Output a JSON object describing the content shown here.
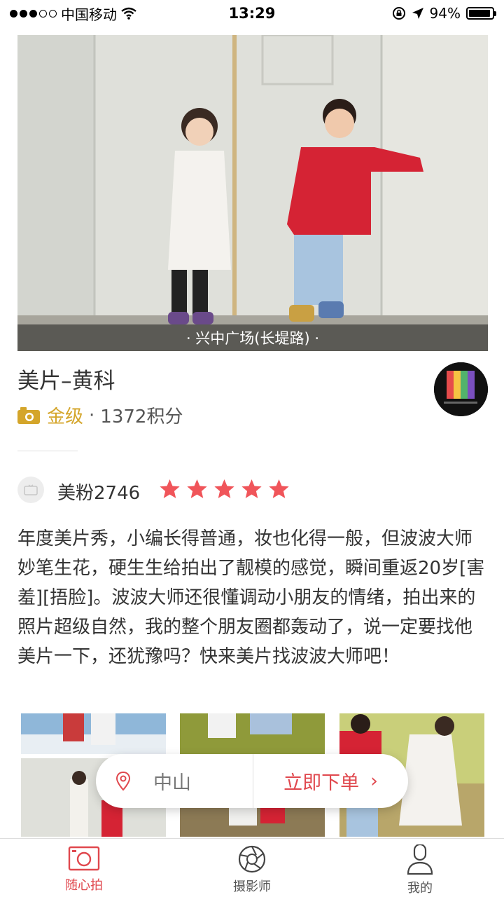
{
  "status_bar": {
    "carrier": "中国移动",
    "time": "13:29",
    "battery": "94%",
    "battery_level": 0.94
  },
  "hero": {
    "location_caption": "· 兴中广场(长堤路) ·"
  },
  "studio": {
    "title": "美片–黄科",
    "level": "金级",
    "separator": "·",
    "points": "1372积分"
  },
  "review": {
    "reviewer": "美粉2746",
    "rating": 5,
    "text": "年度美片秀，小编长得普通，妆也化得一般，但波波大师妙笔生花，硬生生给拍出了靓模的感觉，瞬间重返20岁[害羞][捂脸]。波波大师还很懂调动小朋友的情绪，拍出来的照片超级自然，我的整个朋友圈都轰动了，说一定要找他美片一下，还犹豫吗？快来美片找波波大师吧！"
  },
  "order_bar": {
    "city": "中山",
    "order_label": "立即下单",
    "arrow": "›"
  },
  "tabs": [
    {
      "label": "随心拍",
      "icon": "camera-icon",
      "active": true
    },
    {
      "label": "摄影师",
      "icon": "aperture-icon",
      "active": false
    },
    {
      "label": "我的",
      "icon": "person-icon",
      "active": false
    }
  ],
  "colors": {
    "accent": "#e0484e",
    "gold": "#d4a52a",
    "star": "#f0555a"
  }
}
